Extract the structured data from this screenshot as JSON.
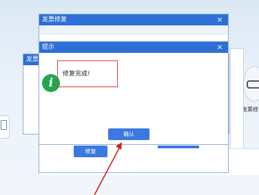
{
  "dialog_top": {
    "title": "发票修复",
    "close": "×"
  },
  "dialog_back": {
    "title": "发票修"
  },
  "dialog_bottom": {
    "button_label": "修复"
  },
  "right_app": {
    "label": "发票修"
  },
  "prompt": {
    "title": "提示",
    "close": "×",
    "message": "修复完成!",
    "info_glyph": "i",
    "ok_label": "确认"
  },
  "colors": {
    "titlebar": "#2d6fd6",
    "button": "#3b78e0",
    "highlight_box": "#d23b3b",
    "arrow": "#d21c1c",
    "info_icon": "#23a650"
  }
}
